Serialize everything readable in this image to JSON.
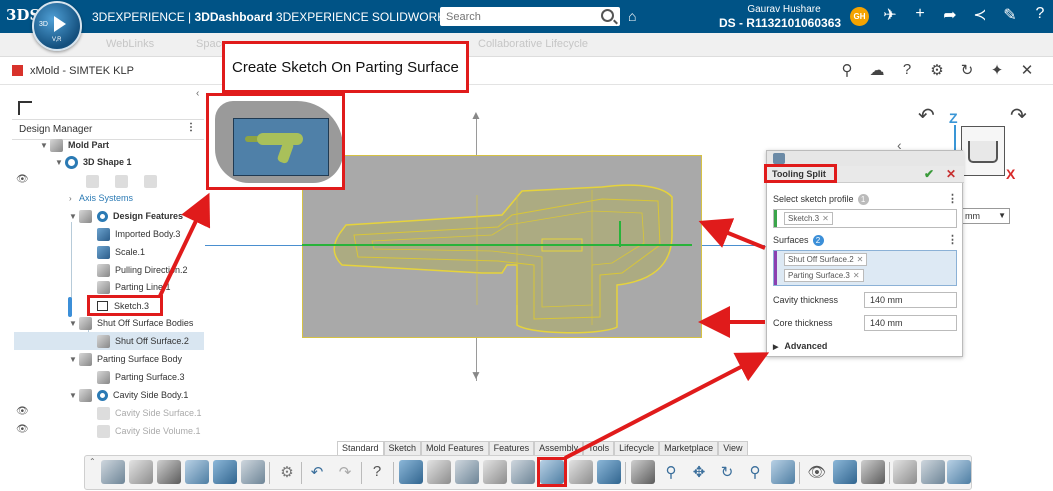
{
  "topbar": {
    "brand": "3DEXPERIENCE",
    "separator": "|",
    "app_name": "3DDashboard",
    "app_context": "3DEXPERIENCE SOLIDWORKS",
    "dropdown": "⌄",
    "search_placeholder": "Search",
    "user_name": "Gaurav Hushare",
    "user_role": "DS - R1132101060363",
    "avatar_initials": "GH",
    "compass_text": "3D",
    "compass_vr": "V,R",
    "logo": "3DS"
  },
  "tabstrip": {
    "items": [
      "WebLinks",
      "Spaces",
      "Collaborative Lifecycle"
    ]
  },
  "app_header": {
    "title": "xMold - SIMTEK KLP"
  },
  "callout": {
    "text": "Create Sketch On Parting Surface"
  },
  "tree": {
    "panel_title": "Design Manager",
    "items": [
      {
        "label": "Mold Part",
        "style": "bold"
      },
      {
        "label": "3D Shape 1",
        "style": "bold"
      },
      {
        "label": "Axis Systems",
        "style": "link"
      },
      {
        "label": "Design Features",
        "style": "bold"
      },
      {
        "label": "Imported Body.3"
      },
      {
        "label": "Scale.1"
      },
      {
        "label": "Pulling Direction.2"
      },
      {
        "label": "Parting Line.1"
      },
      {
        "label": "Sketch.3"
      },
      {
        "label": "Shut Off Surface Bodies"
      },
      {
        "label": "Shut Off Surface.2",
        "style": "selected"
      },
      {
        "label": "Parting Surface Body"
      },
      {
        "label": "Parting Surface.3"
      },
      {
        "label": "Cavity Side Body.1"
      },
      {
        "label": "Cavity Side Surface.1",
        "style": "dim"
      },
      {
        "label": "Cavity Side Volume.1",
        "style": "dim"
      }
    ]
  },
  "dialog": {
    "title": "Tooling Split",
    "select_profile_label": "Select sketch profile",
    "profile_count": "1",
    "profile_chip": "Sketch.3",
    "surfaces_label": "Surfaces",
    "surfaces_count": "2",
    "surface_chips": [
      "Shut Off Surface.2",
      "Parting Surface.3"
    ],
    "cavity_label": "Cavity thickness",
    "cavity_value": "140 mm",
    "core_label": "Core thickness",
    "core_value": "140 mm",
    "advanced_label": "Advanced"
  },
  "orientation": {
    "z_label": "Z",
    "x_label": "X",
    "unit_select": "mm"
  },
  "toolbar": {
    "tabs": [
      "Standard",
      "Sketch",
      "Mold Features",
      "Features",
      "Assembly",
      "Tools",
      "Lifecycle",
      "Marketplace",
      "View"
    ],
    "active_tab": "Standard"
  },
  "colors": {
    "topbar": "#005386",
    "callout_red": "#e01b1b",
    "plane_grey": "#a9a9a9",
    "part_yellow": "#d6c244",
    "axis_blue": "#4a8fcf"
  }
}
